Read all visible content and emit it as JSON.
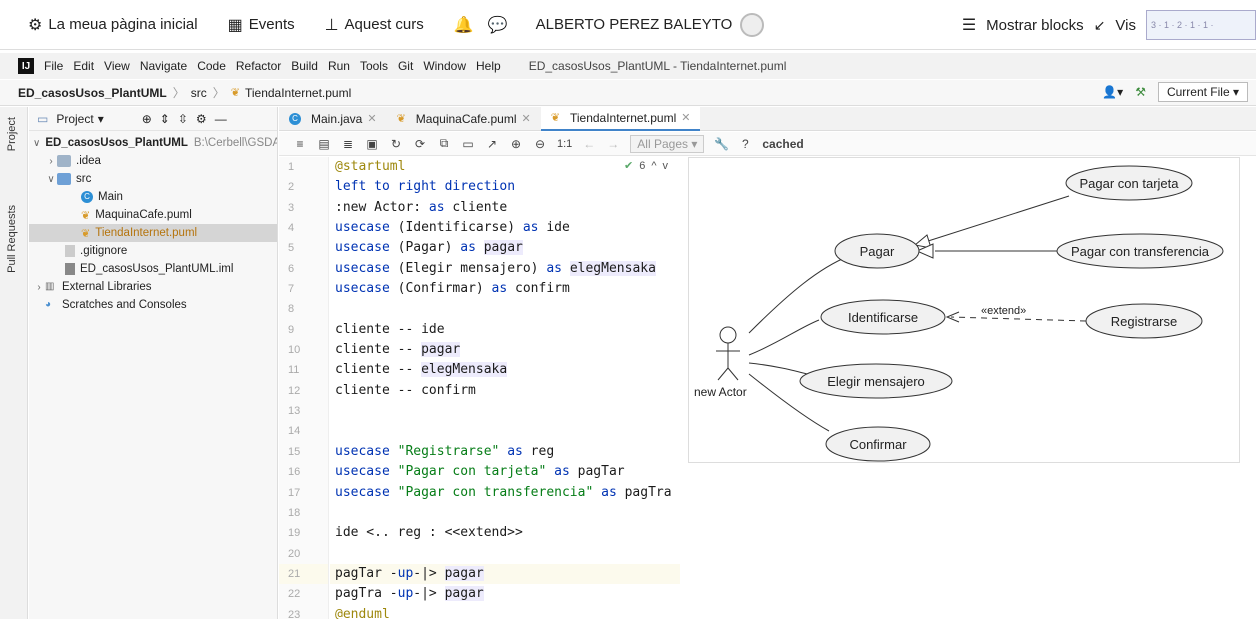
{
  "moodle": {
    "home": "La meua pàgina inicial",
    "events": "Events",
    "course": "Aquest curs",
    "user": "ALBERTO PEREZ BALEYTO",
    "show_blocks": "Mostrar blocks",
    "vis": "Vis"
  },
  "menu": {
    "items": [
      "File",
      "Edit",
      "View",
      "Navigate",
      "Code",
      "Refactor",
      "Build",
      "Run",
      "Tools",
      "Git",
      "Window",
      "Help"
    ],
    "title": "ED_casosUsos_PlantUML - TiendaInternet.puml"
  },
  "nav": {
    "project": "ED_casosUsos_PlantUML",
    "folder": "src",
    "file": "TiendaInternet.puml",
    "current_file": "Current File"
  },
  "sidebar": {
    "project_label": "Project",
    "pull_requests": "Pull Requests"
  },
  "project": {
    "header": "Project",
    "root": "ED_casosUsos_PlantUML",
    "root_path": "B:\\Cerbell\\GSDAW",
    "idea": ".idea",
    "src": "src",
    "main": "Main",
    "maquina": "MaquinaCafe.puml",
    "tienda": "TiendaInternet.puml",
    "gitignore": ".gitignore",
    "iml": "ED_casosUsos_PlantUML.iml",
    "ext_libs": "External Libraries",
    "scratches": "Scratches and Consoles"
  },
  "tabs": [
    "Main.java",
    "MaquinaCafe.puml",
    "TiendaInternet.puml"
  ],
  "toolbar": {
    "zoom": "1:1",
    "all_pages": "All Pages",
    "cached": "cached"
  },
  "inspection": {
    "count": "6"
  },
  "code_lines": [
    "@startuml",
    "left to right direction",
    ":new Actor: as cliente",
    "usecase (Identificarse) as ide",
    "usecase (Pagar) as pagar",
    "usecase (Elegir mensajero) as elegMensaka",
    "usecase (Confirmar) as confirm",
    "",
    "cliente -- ide",
    "cliente -- pagar",
    "cliente -- elegMensaka",
    "cliente -- confirm",
    "",
    "",
    "usecase \"Registrarse\" as reg",
    "usecase \"Pagar con tarjeta\" as pagTar",
    "usecase \"Pagar con transferencia\" as pagTra",
    "",
    "ide <.. reg : <<extend>>",
    "",
    "pagTar -up-|> pagar",
    "pagTra -up-|> pagar",
    "@enduml"
  ],
  "diagram": {
    "actor": "new Actor",
    "uc_pagar": "Pagar",
    "uc_identificarse": "Identificarse",
    "uc_elegir": "Elegir mensajero",
    "uc_confirmar": "Confirmar",
    "uc_tarjeta": "Pagar con tarjeta",
    "uc_transferencia": "Pagar con transferencia",
    "uc_registrarse": "Registrarse",
    "extend_label": "«extend»"
  }
}
